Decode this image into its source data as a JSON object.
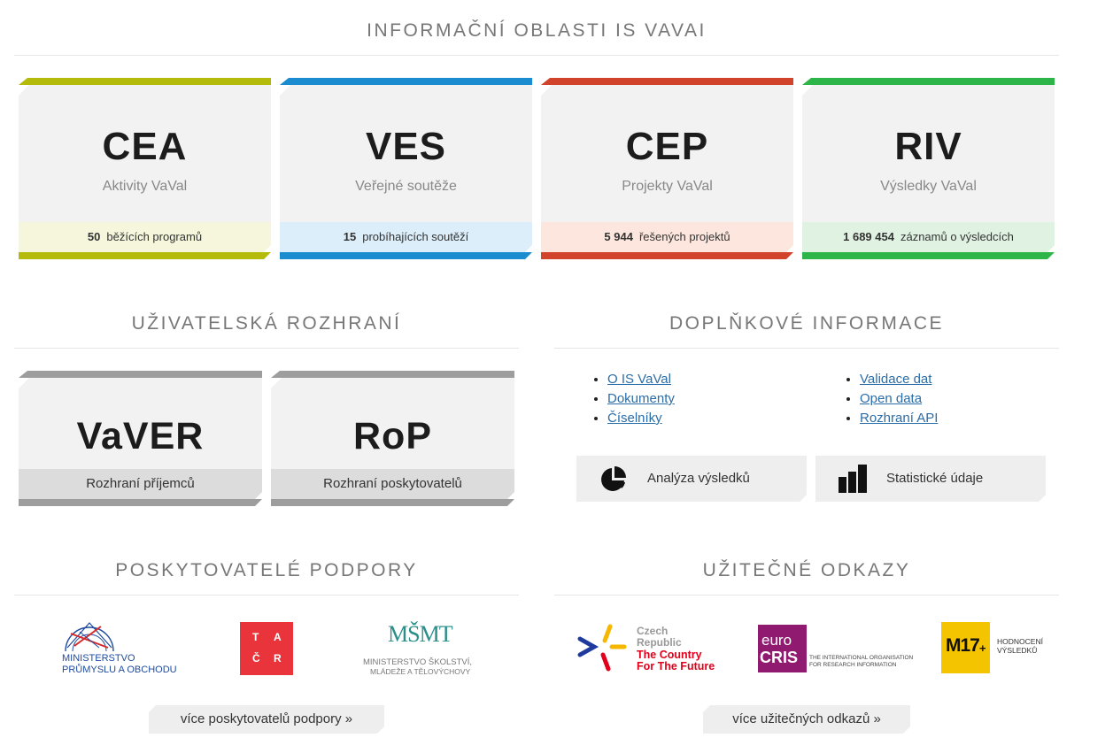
{
  "sections": {
    "info_title": "INFORMAČNÍ OBLASTI IS VAVAI",
    "ui_title": "UŽIVATELSKÁ ROZHRANÍ",
    "extra_title": "DOPLŇKOVÉ INFORMACE",
    "providers_title": "POSKYTOVATELÉ PODPORY",
    "links_title": "UŽITEČNÉ ODKAZY"
  },
  "cards": [
    {
      "abbr": "CEA",
      "subtitle": "Aktivity VaVal",
      "count": "50",
      "stat": "běžících programů",
      "accent": "#b5bb0a",
      "stat_bg": "#f6f6dc"
    },
    {
      "abbr": "VES",
      "subtitle": "Veřejné soutěže",
      "count": "15",
      "stat": "probíhajících soutěží",
      "accent": "#1a8ccf",
      "stat_bg": "#dbeefa"
    },
    {
      "abbr": "CEP",
      "subtitle": "Projekty VaVal",
      "count": "5 944",
      "stat": "řešených projektů",
      "accent": "#d1432b",
      "stat_bg": "#fce6dd"
    },
    {
      "abbr": "RIV",
      "subtitle": "Výsledky VaVal",
      "count": "1 689 454",
      "stat": "záznamů o výsledcích",
      "accent": "#2db54a",
      "stat_bg": "#e0f2e2"
    }
  ],
  "interfaces": [
    {
      "abbr": "VaVER",
      "label": "Rozhraní příjemců"
    },
    {
      "abbr": "RoP",
      "label": "Rozhraní poskytovatelů"
    }
  ],
  "extra": {
    "links_left": [
      "O IS VaVal",
      "Dokumenty",
      "Číselníky"
    ],
    "links_right": [
      "Validace dat",
      "Open data",
      "Rozhraní API"
    ],
    "tile_analysis": "Analýza výsledků",
    "tile_stats": "Statistické údaje",
    "icon_analysis": "pie-chart-icon",
    "icon_stats": "bar-chart-icon"
  },
  "providers": {
    "mpo_line1": "MINISTERSTVO",
    "mpo_line2": "PRŮMYSLU A OBCHODU",
    "tacr_letters": [
      "T",
      "A",
      "Č",
      "R"
    ],
    "msmt_mark": "MŠMT",
    "msmt_line1": "MINISTERSTVO ŠKOLSTVÍ,",
    "msmt_line2": "MLÁDEŽE A TĚLOVÝCHOVY",
    "more_label": "více poskytovatelů podpory »"
  },
  "useful": {
    "cz_line1": "Czech",
    "cz_line2": "Republic",
    "cz_line3": "The Country",
    "cz_line4": "For The Future",
    "eurocris_top": "euro",
    "eurocris_bottom": "CRIS",
    "eurocris_line1": "THE INTERNATIONAL ORGANISATION",
    "eurocris_line2": "FOR RESEARCH INFORMATION",
    "m17_mark": "M17",
    "m17_plus": "+",
    "m17_line1": "HODNOCENÍ",
    "m17_line2": "VÝSLEDKŮ",
    "more_label": "více užitečných odkazů »"
  },
  "colors": {
    "cea": "#b5bb0a",
    "ves": "#1a8ccf",
    "cep": "#d1432b",
    "riv": "#2db54a",
    "tacr": "#e8343a",
    "mpo": "#1e4a9e",
    "msmt": "#2a8f8a",
    "cz_red": "#e2001a",
    "eurocris": "#8f1a6f",
    "m17": "#f5c400"
  }
}
